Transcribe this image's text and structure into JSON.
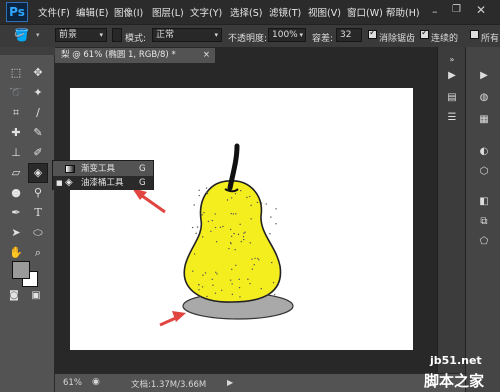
{
  "app": {
    "logo": "Ps"
  },
  "menu": [
    "文件(F)",
    "编辑(E)",
    "图像(I)",
    "图层(L)",
    "文字(Y)",
    "选择(S)",
    "滤镜(T)",
    "视图(V)",
    "窗口(W)",
    "帮助(H)"
  ],
  "options": {
    "fill_source": "前景",
    "mode_label": "模式:",
    "mode_value": "正常",
    "opacity_label": "不透明度:",
    "opacity_value": "100%",
    "tolerance_label": "容差:",
    "tolerance_value": "32",
    "antialias_label": "消除锯齿",
    "contiguous_label": "连续的",
    "all_layers_label": "所有"
  },
  "document": {
    "tab_title": "梨 @ 61% (椭圆 1, RGB/8) *",
    "close": "×"
  },
  "flyout": {
    "items": [
      {
        "label": "渐变工具",
        "shortcut": "G",
        "selected": false
      },
      {
        "label": "油漆桶工具",
        "shortcut": "G",
        "selected": true
      }
    ]
  },
  "status": {
    "zoom": "61%",
    "doc_info": "文档:1.37M/3.66M"
  },
  "watermark": {
    "line1": "jb51.net",
    "line2": "脚本之家"
  },
  "colors": {
    "pear_fill": "#f5ee1e",
    "shadow_fill": "#a9a9a9",
    "arrow": "#e0453f",
    "foreground_swatch": "#9a9a9a",
    "background_swatch": "#ffffff"
  },
  "icons": {
    "toolbar": [
      "move-icon",
      "marquee-icon",
      "lasso-icon",
      "magic-wand-icon",
      "crop-icon",
      "eyedropper-icon",
      "healing-icon",
      "brush-icon",
      "stamp-icon",
      "history-brush-icon",
      "eraser-icon",
      "paint-bucket-icon",
      "blur-icon",
      "dodge-icon",
      "pen-icon",
      "text-icon",
      "path-select-icon",
      "shape-icon",
      "hand-icon",
      "zoom-icon"
    ]
  }
}
